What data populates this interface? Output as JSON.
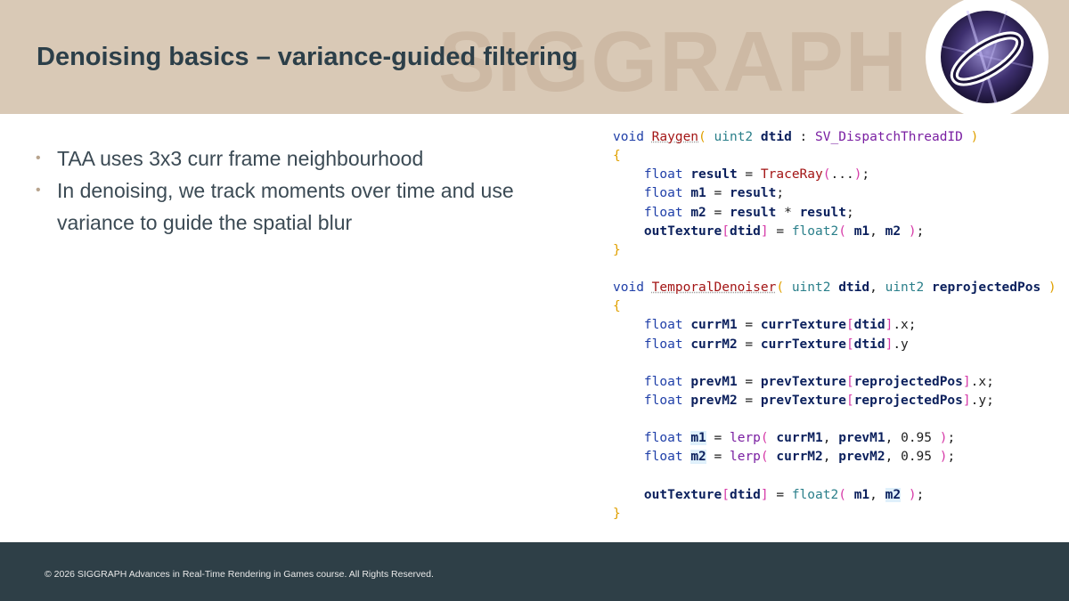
{
  "slide": {
    "title": "Denoising basics – variance-guided filtering",
    "watermark": "SIGGRAPH",
    "bullet_marker": "•",
    "bullets": [
      "TAA uses 3x3 curr frame neighbourhood",
      "In denoising, we track moments over time and use variance to guide the spatial blur"
    ],
    "footer": "© 2026 SIGGRAPH Advances in Real-Time Rendering in Games course. All Rights Reserved.",
    "logo_icon": "siggraph-advances-logo-icon"
  },
  "code": {
    "lines": [
      [
        [
          "kw",
          "void "
        ],
        [
          "fn squig",
          "Raygen"
        ],
        [
          "brk",
          "( "
        ],
        [
          "typ",
          "uint2 "
        ],
        [
          "var",
          "dtid"
        ],
        [
          "pl",
          " : "
        ],
        [
          "sem",
          "SV_DispatchThreadID"
        ],
        [
          "brk",
          " )"
        ]
      ],
      [
        [
          "brk",
          "{"
        ]
      ],
      [
        [
          "pl",
          "    "
        ],
        [
          "kw",
          "float "
        ],
        [
          "var",
          "result"
        ],
        [
          "pl",
          " = "
        ],
        [
          "fn",
          "TraceRay"
        ],
        [
          "br2",
          "("
        ],
        [
          "pl",
          "..."
        ],
        [
          "br2",
          ")"
        ],
        [
          "pl",
          ";"
        ]
      ],
      [
        [
          "pl",
          "    "
        ],
        [
          "kw",
          "float "
        ],
        [
          "var",
          "m1"
        ],
        [
          "pl",
          " = "
        ],
        [
          "var",
          "result"
        ],
        [
          "pl",
          ";"
        ]
      ],
      [
        [
          "pl",
          "    "
        ],
        [
          "kw",
          "float "
        ],
        [
          "var",
          "m2"
        ],
        [
          "pl",
          " = "
        ],
        [
          "var",
          "result"
        ],
        [
          "pl",
          " * "
        ],
        [
          "var",
          "result"
        ],
        [
          "pl",
          ";"
        ]
      ],
      [
        [
          "pl",
          "    "
        ],
        [
          "var",
          "outTexture"
        ],
        [
          "br2",
          "["
        ],
        [
          "var",
          "dtid"
        ],
        [
          "br2",
          "]"
        ],
        [
          "pl",
          " = "
        ],
        [
          "typ",
          "float2"
        ],
        [
          "br2",
          "( "
        ],
        [
          "var",
          "m1"
        ],
        [
          "pl",
          ", "
        ],
        [
          "var",
          "m2"
        ],
        [
          "br2",
          " )"
        ],
        [
          "pl",
          ";"
        ]
      ],
      [
        [
          "brk",
          "}"
        ]
      ],
      [],
      [
        [
          "kw",
          "void "
        ],
        [
          "fn squig",
          "TemporalDenoiser"
        ],
        [
          "brk",
          "( "
        ],
        [
          "typ",
          "uint2 "
        ],
        [
          "var",
          "dtid"
        ],
        [
          "pl",
          ", "
        ],
        [
          "typ",
          "uint2 "
        ],
        [
          "var",
          "reprojectedPos"
        ],
        [
          "brk",
          " )"
        ]
      ],
      [
        [
          "brk",
          "{"
        ]
      ],
      [
        [
          "pl",
          "    "
        ],
        [
          "kw",
          "float "
        ],
        [
          "var",
          "currM1"
        ],
        [
          "pl",
          " = "
        ],
        [
          "var",
          "currTexture"
        ],
        [
          "br2",
          "["
        ],
        [
          "var",
          "dtid"
        ],
        [
          "br2",
          "]"
        ],
        [
          "pl",
          ".x;"
        ]
      ],
      [
        [
          "pl",
          "    "
        ],
        [
          "kw",
          "float "
        ],
        [
          "var",
          "currM2"
        ],
        [
          "pl",
          " = "
        ],
        [
          "var",
          "currTexture"
        ],
        [
          "br2",
          "["
        ],
        [
          "var",
          "dtid"
        ],
        [
          "br2",
          "]"
        ],
        [
          "pl",
          ".y"
        ]
      ],
      [],
      [
        [
          "pl",
          "    "
        ],
        [
          "kw",
          "float "
        ],
        [
          "var",
          "prevM1"
        ],
        [
          "pl",
          " = "
        ],
        [
          "var",
          "prevTexture"
        ],
        [
          "br2",
          "["
        ],
        [
          "var",
          "reprojectedPos"
        ],
        [
          "br2",
          "]"
        ],
        [
          "pl",
          ".x;"
        ]
      ],
      [
        [
          "pl",
          "    "
        ],
        [
          "kw",
          "float "
        ],
        [
          "var",
          "prevM2"
        ],
        [
          "pl",
          " = "
        ],
        [
          "var",
          "prevTexture"
        ],
        [
          "br2",
          "["
        ],
        [
          "var",
          "reprojectedPos"
        ],
        [
          "br2",
          "]"
        ],
        [
          "pl",
          ".y;"
        ]
      ],
      [],
      [
        [
          "pl",
          "    "
        ],
        [
          "kw",
          "float "
        ],
        [
          "var hl",
          "m1"
        ],
        [
          "pl",
          " = "
        ],
        [
          "sem",
          "lerp"
        ],
        [
          "br2",
          "( "
        ],
        [
          "var",
          "currM1"
        ],
        [
          "pl",
          ", "
        ],
        [
          "var",
          "prevM1"
        ],
        [
          "pl",
          ", "
        ],
        [
          "num",
          "0.95"
        ],
        [
          "br2",
          " )"
        ],
        [
          "pl",
          ";"
        ]
      ],
      [
        [
          "pl",
          "    "
        ],
        [
          "kw",
          "float "
        ],
        [
          "var hl",
          "m2"
        ],
        [
          "pl",
          " = "
        ],
        [
          "sem",
          "lerp"
        ],
        [
          "br2",
          "( "
        ],
        [
          "var",
          "currM2"
        ],
        [
          "pl",
          ", "
        ],
        [
          "var",
          "prevM2"
        ],
        [
          "pl",
          ", "
        ],
        [
          "num",
          "0.95"
        ],
        [
          "br2",
          " )"
        ],
        [
          "pl",
          ";"
        ]
      ],
      [],
      [
        [
          "pl",
          "    "
        ],
        [
          "var",
          "outTexture"
        ],
        [
          "br2",
          "["
        ],
        [
          "var",
          "dtid"
        ],
        [
          "br2",
          "]"
        ],
        [
          "pl",
          " = "
        ],
        [
          "typ",
          "float2"
        ],
        [
          "br2",
          "( "
        ],
        [
          "var",
          "m1"
        ],
        [
          "pl",
          ", "
        ],
        [
          "var hl",
          "m2"
        ],
        [
          "br2",
          " )"
        ],
        [
          "pl",
          ";"
        ]
      ],
      [
        [
          "brk",
          "}"
        ]
      ]
    ]
  },
  "colors": {
    "header_bg": "#d9c9b6",
    "title": "#2c3f49",
    "footer_bg": "#2e3f47",
    "accent": "#b8a48e"
  }
}
